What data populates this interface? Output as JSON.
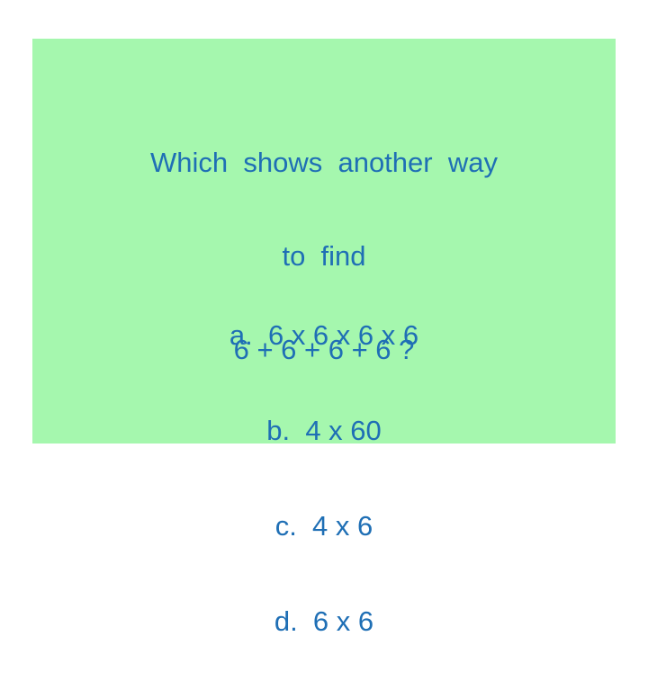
{
  "slide": {
    "background_color": "#ffffff",
    "panel_color": "#a5f7ae",
    "text_color": "#1f6fb5",
    "question": {
      "line1": "Which  shows  another  way",
      "line2": "to  find",
      "line3": "6 + 6 + 6 + 6 ?"
    },
    "choices": [
      {
        "label": "a.",
        "text": "6 x 6 x 6 x 6",
        "full": "a.  6 x 6 x 6 x 6"
      },
      {
        "label": "b.",
        "text": "4 x 60",
        "full": "b.  4 x 60"
      },
      {
        "label": "c.",
        "text": "4 x 6",
        "full": "c.  4 x 6"
      },
      {
        "label": "d.",
        "text": "6 x 6",
        "full": "d.  6 x 6"
      }
    ]
  }
}
